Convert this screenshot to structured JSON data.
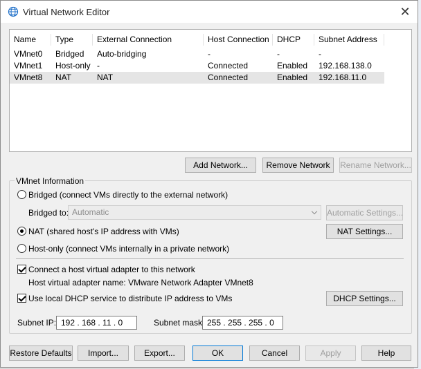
{
  "window": {
    "title": "Virtual Network Editor",
    "icon": "globe-icon",
    "close_label": "✕"
  },
  "table": {
    "columns": [
      "Name",
      "Type",
      "External Connection",
      "Host Connection",
      "DHCP",
      "Subnet Address"
    ],
    "rows": [
      [
        "VMnet0",
        "Bridged",
        "Auto-bridging",
        "-",
        "-",
        "-"
      ],
      [
        "VMnet1",
        "Host-only",
        "-",
        "Connected",
        "Enabled",
        "192.168.138.0"
      ],
      [
        "VMnet8",
        "NAT",
        "NAT",
        "Connected",
        "Enabled",
        "192.168.11.0"
      ]
    ],
    "selected_row": 2
  },
  "table_buttons": {
    "add": "Add Network...",
    "remove": "Remove Network",
    "rename": "Rename Network..."
  },
  "vmnet_info": {
    "group_label": "VMnet Information",
    "bridged_label": "Bridged (connect VMs directly to the external network)",
    "bridged_to_label": "Bridged to:",
    "bridged_to_value": "Automatic",
    "auto_settings": "Automatic Settings...",
    "nat_label": "NAT (shared host's IP address with VMs)",
    "nat_settings": "NAT Settings...",
    "hostonly_label": "Host-only (connect VMs internally in a private network)",
    "connect_adapter_label": "Connect a host virtual adapter to this network",
    "adapter_name_label": "Host virtual adapter name: VMware Network Adapter VMnet8",
    "dhcp_label": "Use local DHCP service to distribute IP address to VMs",
    "dhcp_settings": "DHCP Settings...",
    "subnet_ip_label": "Subnet IP:",
    "subnet_ip_value": "192 . 168 . 11  .  0",
    "subnet_mask_label": "Subnet mask:",
    "subnet_mask_value": "255 . 255 . 255 .  0",
    "selected_mode": "nat",
    "connect_adapter_checked": true,
    "dhcp_checked": true
  },
  "footer_buttons": {
    "restore": "Restore Defaults",
    "import": "Import...",
    "export": "Export...",
    "ok": "OK",
    "cancel": "Cancel",
    "apply": "Apply",
    "help": "Help"
  },
  "colors": {
    "accent": "#0078d7",
    "selected_row": "#e5e5e5",
    "disabled_text": "#a0a0a0"
  }
}
